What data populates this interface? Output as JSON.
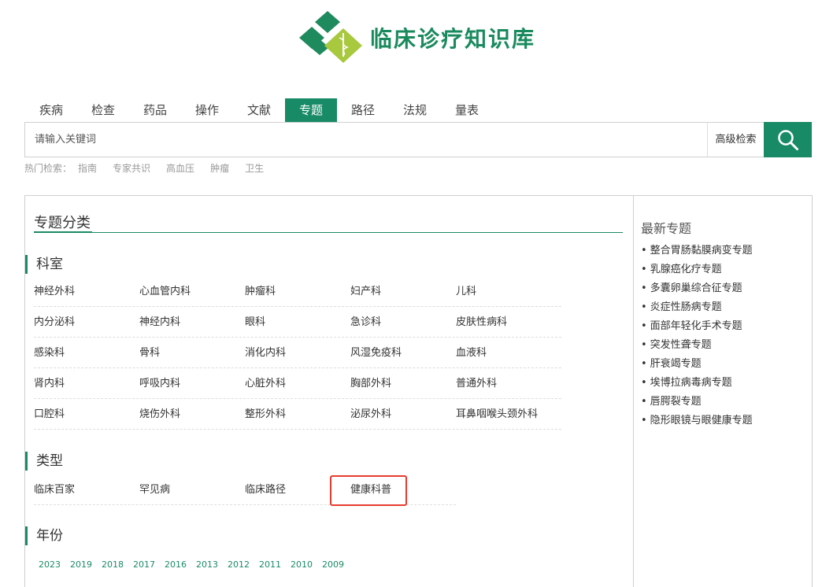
{
  "header": {
    "logo_text": "临床诊疗知识库"
  },
  "nav": {
    "tabs": [
      {
        "label": "疾病",
        "active": false
      },
      {
        "label": "检查",
        "active": false
      },
      {
        "label": "药品",
        "active": false
      },
      {
        "label": "操作",
        "active": false
      },
      {
        "label": "文献",
        "active": false
      },
      {
        "label": "专题",
        "active": true
      },
      {
        "label": "路径",
        "active": false
      },
      {
        "label": "法规",
        "active": false
      },
      {
        "label": "量表",
        "active": false
      }
    ]
  },
  "search": {
    "placeholder": "请输入关键词",
    "advanced_label": "高级检索",
    "search_icon": "search-icon"
  },
  "hot_search": {
    "label": "热门检索：",
    "items": [
      "指南",
      "专家共识",
      "高血压",
      "肿瘤",
      "卫生"
    ]
  },
  "main": {
    "title": "专题分类",
    "departments": {
      "heading": "科室",
      "rows": [
        [
          "神经外科",
          "心血管内科",
          "肿瘤科",
          "妇产科",
          "儿科"
        ],
        [
          "内分泌科",
          "神经内科",
          "眼科",
          "急诊科",
          "皮肤性病科"
        ],
        [
          "感染科",
          "骨科",
          "消化内科",
          "风湿免疫科",
          "血液科"
        ],
        [
          "肾内科",
          "呼吸内科",
          "心脏外科",
          "胸部外科",
          "普通外科"
        ],
        [
          "口腔科",
          "烧伤外科",
          "整形外科",
          "泌尿外科",
          "耳鼻咽喉头颈外科"
        ]
      ]
    },
    "types": {
      "heading": "类型",
      "items": [
        "临床百家",
        "罕见病",
        "临床路径",
        "健康科普"
      ]
    },
    "years": {
      "heading": "年份",
      "items": [
        "2023",
        "2019",
        "2018",
        "2017",
        "2016",
        "2013",
        "2012",
        "2011",
        "2010",
        "2009"
      ]
    }
  },
  "sidebar": {
    "title": "最新专题",
    "items": [
      "整合胃肠黏膜病变专题",
      "乳腺癌化疗专题",
      "多囊卵巢综合征专题",
      "炎症性肠病专题",
      "面部年轻化手术专题",
      "突发性聋专题",
      "肝衰竭专题",
      "埃博拉病毒病专题",
      "唇腭裂专题",
      "隐形眼镜与眼健康专题"
    ]
  },
  "colors": {
    "accent": "#198a66",
    "highlight": "#e63b2e"
  }
}
